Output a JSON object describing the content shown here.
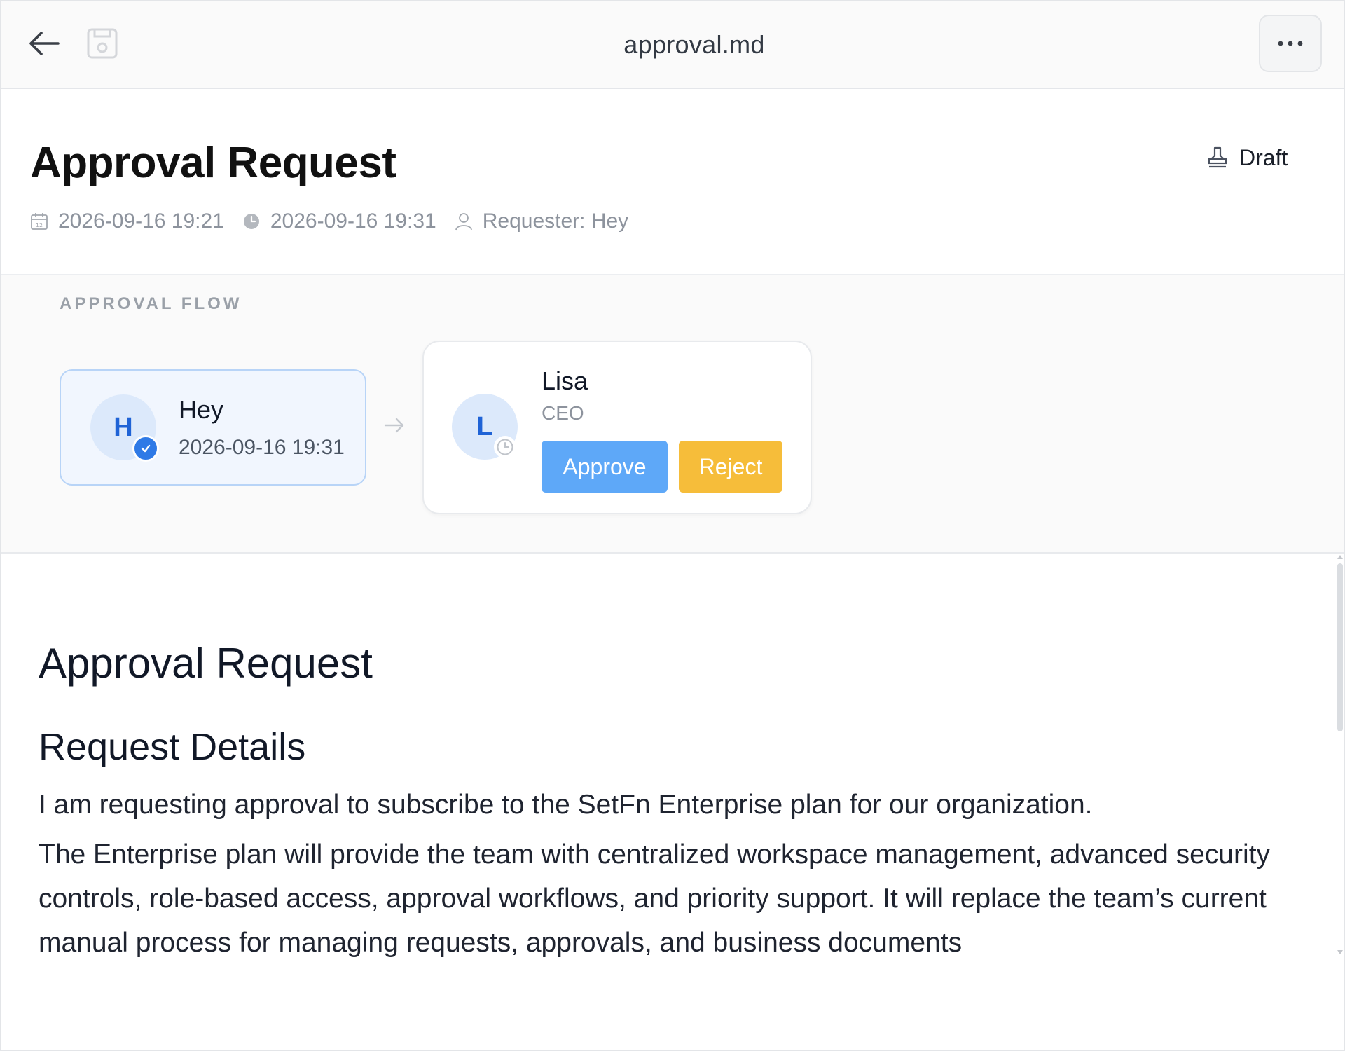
{
  "window": {
    "file_title": "approval.md",
    "icons": {
      "back": "arrow-left-icon",
      "save": "save-disk-icon",
      "more": "ellipsis-icon"
    }
  },
  "header": {
    "title": "Approval Request",
    "status": {
      "label": "Draft",
      "icon": "stamp-icon"
    },
    "meta": {
      "created": "2026-09-16 19:21",
      "updated": "2026-09-16 19:31",
      "requester": "Requester: Hey"
    }
  },
  "flow": {
    "label": "APPROVAL FLOW",
    "steps": [
      {
        "initial": "H",
        "name": "Hey",
        "date": "2026-09-16 19:31",
        "state": "approved"
      },
      {
        "initial": "L",
        "name": "Lisa",
        "role": "CEO",
        "state": "pending",
        "approve_label": "Approve",
        "reject_label": "Reject"
      }
    ]
  },
  "content": {
    "h1": "Approval Request",
    "h2": "Request Details",
    "paragraphs": [
      "I am requesting approval to subscribe to the SetFn Enterprise plan for our organization.",
      "The Enterprise plan will provide the team with centralized workspace management, advanced security controls, role-based access, approval workflows, and priority support. It will replace the team’s current manual process for managing requests, approvals, and business documents"
    ]
  },
  "colors": {
    "accent_blue": "#5ea8f8",
    "reject_yellow": "#f6bd3a",
    "avatar_text": "#1f63d6",
    "check_badge": "#2f7ae6"
  }
}
